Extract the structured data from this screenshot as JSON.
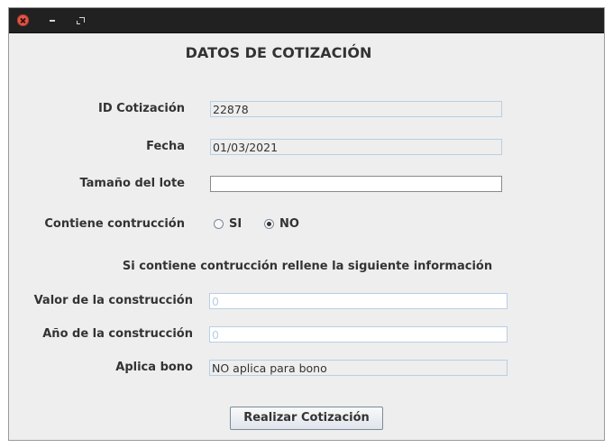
{
  "window": {
    "controls": [
      "close-icon",
      "minimize-icon",
      "maximize-icon"
    ]
  },
  "form": {
    "title": "DATOS DE COTIZACIÓN",
    "id_label": "ID Cotización",
    "id_value": "22878",
    "fecha_label": "Fecha",
    "fecha_value": "01/03/2021",
    "tamano_label": "Tamaño del lote",
    "tamano_value": "",
    "contiene_label": "Contiene contrucción",
    "radio_si": "SI",
    "radio_no": "NO",
    "radio_selected": "NO",
    "note": "Si contiene contrucción rellene la siguiente información",
    "valor_label": "Valor de la construcción",
    "valor_value": "0",
    "anio_label": "Año de la construcción",
    "anio_value": "0",
    "bono_label": "Aplica bono",
    "bono_value": "NO aplica para bono",
    "submit_label": "Realizar Cotización"
  }
}
